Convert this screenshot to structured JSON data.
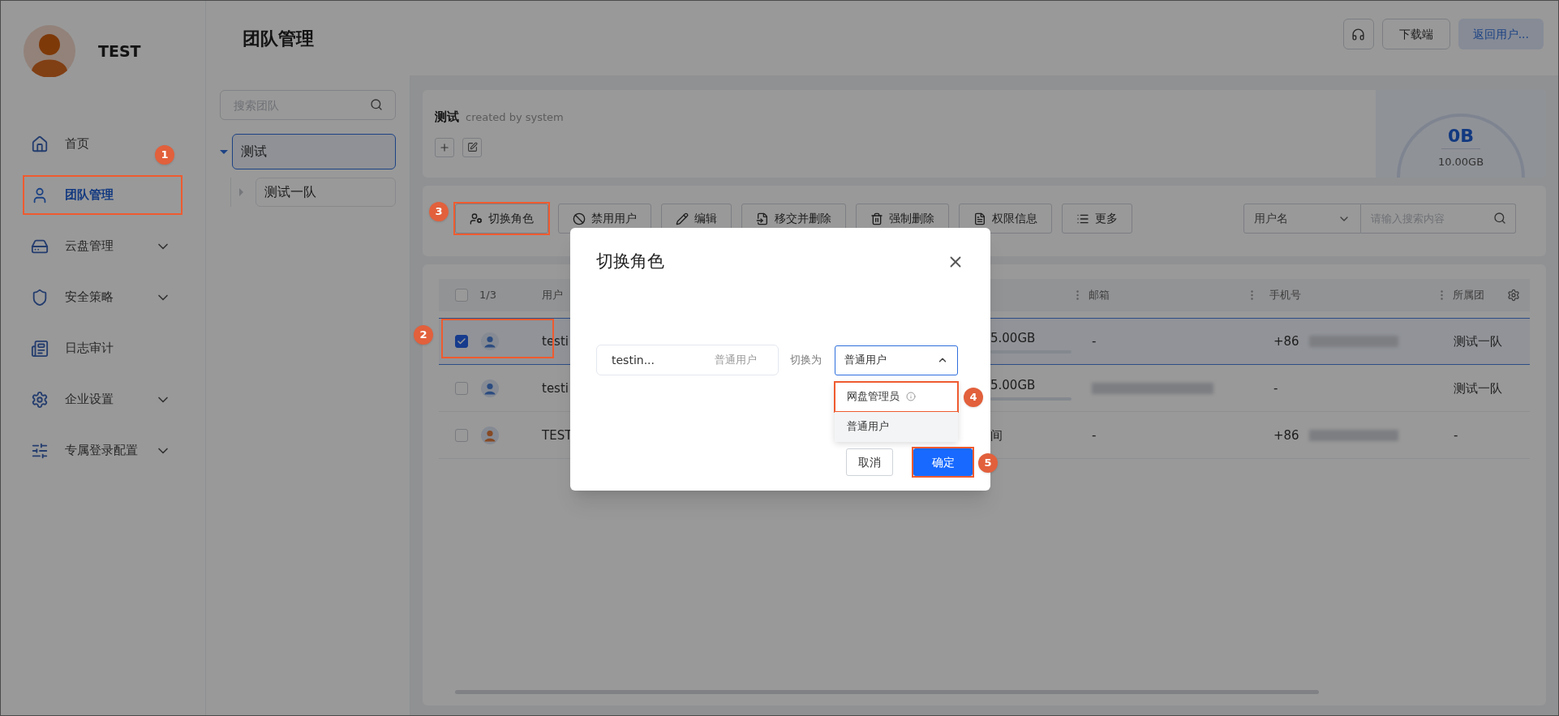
{
  "profile": {
    "name": "TEST"
  },
  "sidebar": {
    "items": [
      {
        "label": "首页",
        "selected": false,
        "expandable": false
      },
      {
        "label": "团队管理",
        "selected": true,
        "expandable": false,
        "step": "1"
      },
      {
        "label": "云盘管理",
        "selected": false,
        "expandable": true
      },
      {
        "label": "安全策略",
        "selected": false,
        "expandable": true
      },
      {
        "label": "日志审计",
        "selected": false,
        "expandable": false
      },
      {
        "label": "企业设置",
        "selected": false,
        "expandable": true
      },
      {
        "label": "专属登录配置",
        "selected": false,
        "expandable": true
      }
    ]
  },
  "header": {
    "title": "团队管理",
    "buttons": [
      {
        "kind": "icon"
      },
      {
        "kind": "default",
        "label": "下载端"
      },
      {
        "kind": "light",
        "label": "返回用户..."
      }
    ]
  },
  "team_search": {
    "placeholder": "搜索团队"
  },
  "team_tree": [
    {
      "label": "测试",
      "selected": true,
      "expanded": true,
      "children": [
        {
          "label": "测试一队",
          "selected": false,
          "expanded": false
        }
      ]
    }
  ],
  "team_card": {
    "name": "测试",
    "subtitle": "created by system",
    "used": "0B",
    "total": "10.00GB"
  },
  "toolbar": {
    "buttons": [
      {
        "label": "切换角色",
        "step": "3"
      },
      {
        "label": "禁用用户"
      },
      {
        "label": "编辑"
      },
      {
        "label": "移交并删除"
      },
      {
        "label": "强制删除"
      },
      {
        "label": "权限信息"
      },
      {
        "label": "更多"
      }
    ],
    "filter": {
      "value": "用户名",
      "placeholder": "请输入搜索内容"
    }
  },
  "table": {
    "count": "1/3",
    "all_checked": false,
    "columns": {
      "user": "用户",
      "email": "邮箱",
      "phone": "手机号",
      "team": "所属团"
    },
    "rows": [
      {
        "checked": true,
        "selected": true,
        "step": "2",
        "color": "#2c4c80",
        "user": "testi",
        "quota": "5.00GB",
        "level": 0,
        "email": "-",
        "phone": "+86",
        "phone_redacted": true,
        "team": "测试一队"
      },
      {
        "checked": false,
        "selected": false,
        "color": "#2c4c80",
        "user": "testi",
        "quota": "5.00GB",
        "level": 0,
        "email_redacted": true,
        "phone": "-",
        "team": "测试一队"
      },
      {
        "checked": false,
        "selected": false,
        "color": "#864923",
        "user": "TEST",
        "quota": "间",
        "email": "-",
        "phone": "+86",
        "phone_redacted": true,
        "team": "-"
      }
    ]
  },
  "dialog": {
    "title": "切换角色",
    "user": "testin...",
    "current_role": "普通用户",
    "switch_label": "切换为",
    "select": {
      "value": "普通用户",
      "expanded": true,
      "options": [
        {
          "label": "网盘管理员",
          "selected": false,
          "info": true,
          "step": "4"
        },
        {
          "label": "普通用户",
          "selected": true,
          "info": false
        }
      ]
    },
    "buttons": [
      {
        "kind": "default",
        "label": "取消"
      },
      {
        "kind": "primary",
        "label": "确定",
        "step": "5"
      }
    ]
  }
}
